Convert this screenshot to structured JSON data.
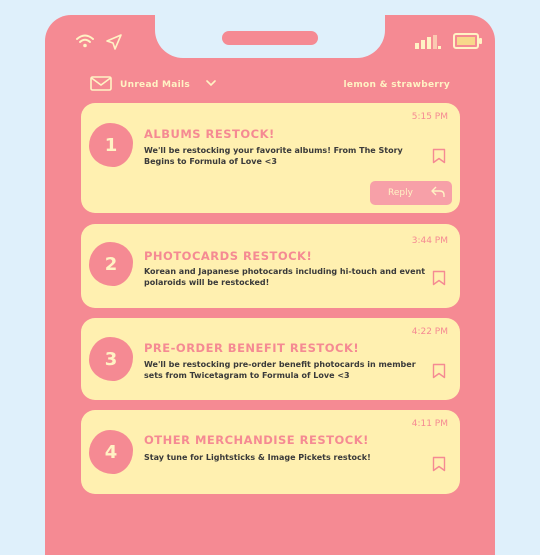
{
  "status": {
    "icons": [
      "wifi-icon",
      "location-arrow-icon",
      "signal-bars-icon",
      "battery-icon"
    ]
  },
  "mailbox": {
    "label": "Unread Mails",
    "account": "lemon & strawberry"
  },
  "messages": [
    {
      "number": "1",
      "title": "ALBUMS RESTOCK!",
      "time": "5:15 PM",
      "body": "We'll be restocking your favorite albums! From The Story Begins to Formula of Love <3",
      "reply_label": "Reply"
    },
    {
      "number": "2",
      "title": "PHOTOCARDS RESTOCK!",
      "time": "3:44 PM",
      "body": "Korean and Japanese photocards including hi-touch and event polaroids will be restocked!"
    },
    {
      "number": "3",
      "title": "PRE-ORDER BENEFIT RESTOCK!",
      "time": "4:22 PM",
      "body": "We'll be restocking pre-order benefit photocards in member sets from Twicetagram to Formula of Love <3"
    },
    {
      "number": "4",
      "title": "OTHER MERCHANDISE RESTOCK!",
      "time": "4:11 PM",
      "body": "Stay tune for Lightsticks & Image Pickets restock!"
    }
  ],
  "colors": {
    "background": "#dff0fb",
    "phone": "#f58a93",
    "card": "#fff0b0",
    "accent_text": "#fff3c4"
  }
}
